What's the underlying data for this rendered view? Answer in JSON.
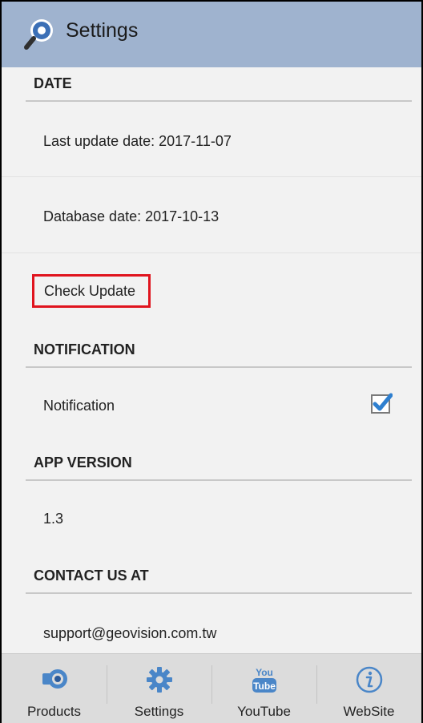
{
  "appbar": {
    "title": "Settings",
    "icon": "search-magnifier-icon"
  },
  "sections": {
    "date": {
      "header": "DATE"
    },
    "notification": {
      "header": "NOTIFICATION"
    },
    "app_version": {
      "header": "APP VERSION"
    },
    "contact": {
      "header": "CONTACT US AT"
    }
  },
  "rows": {
    "last_update": "Last update date: 2017-11-07",
    "database_date": "Database date: 2017-10-13",
    "check_update": "Check Update",
    "notification_label": "Notification",
    "notification_checked": true,
    "version": "1.3",
    "email": "support@geovision.com.tw"
  },
  "nav": {
    "products": "Products",
    "settings": "Settings",
    "youtube": "YouTube",
    "website": "WebSite",
    "youtube_logo_top": "You",
    "youtube_logo_bottom": "Tube"
  },
  "colors": {
    "appbar": "#9fb3cf",
    "accent": "#2e7fcf",
    "highlight": "#e0141e"
  }
}
